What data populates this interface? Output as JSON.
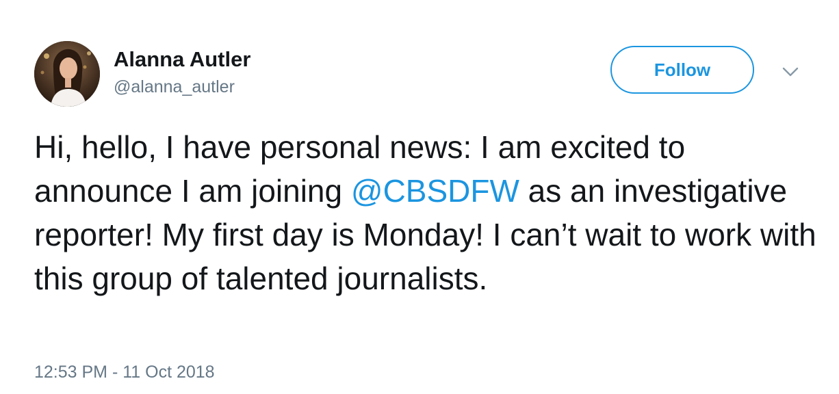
{
  "author": {
    "display_name": "Alanna Autler",
    "handle": "@alanna_autler",
    "avatar_icon": "profile-photo"
  },
  "follow_button": {
    "label": "Follow",
    "color": "#1b95e0"
  },
  "menu": {
    "icon": "chevron-down-icon"
  },
  "tweet": {
    "text_before": "Hi, hello, I have personal news: I am excited to announce I am joining ",
    "mention": "@CBSDFW",
    "text_after": " as an investigative reporter! My first day is Monday! I can’t wait to work with this group of talented journalists.",
    "timestamp": "12:53 PM - 11 Oct 2018"
  },
  "colors": {
    "text": "#14171a",
    "muted": "#657786",
    "link": "#1b95e0"
  }
}
